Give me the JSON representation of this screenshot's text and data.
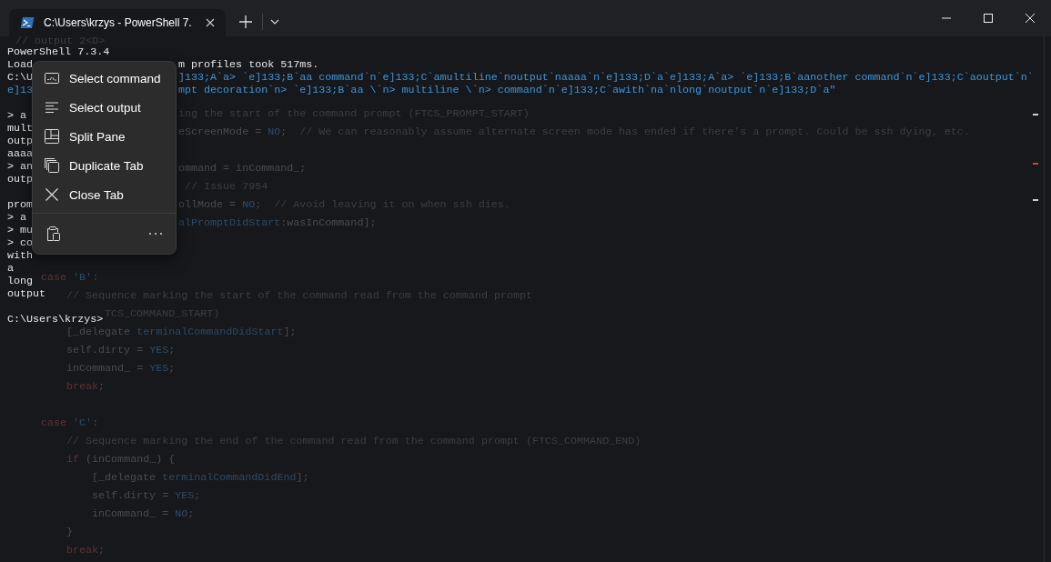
{
  "window": {
    "tabs": [
      {
        "title": "C:\\Users\\krzys - PowerShell 7.",
        "selected": true
      }
    ]
  },
  "terminal": {
    "rows": [
      {
        "kind": "text",
        "text": "PowerShell 7.3.4"
      },
      {
        "kind": "split",
        "left": {
          "text": "Load",
          "kind": "output"
        },
        "right": {
          "text": "m profiles took 517ms.",
          "kind": "output"
        }
      },
      {
        "kind": "split",
        "left": {
          "text": "C:\\U",
          "kind": "output"
        },
        "right": {
          "text": "]133;A`a> `e]133;B`aa command`n`e]133;C`amultiline`noutput`naaaa`n`e]133;D`a`e]133;A`a> `e]133;B`aanother command`n`e]133;C`aoutput`n`",
          "kind": "escape"
        }
      },
      {
        "kind": "split",
        "left": {
          "text": "e]13",
          "kind": "escape"
        },
        "right": {
          "text": "mpt decoration`n> `e]133;B`aa \\`n> multiline \\`n> command`n`e]133;C`awith`na`nlong`noutput`n`e]133;D`a\"",
          "kind": "escape"
        }
      },
      {
        "kind": "blank"
      },
      {
        "kind": "text",
        "text": "> a"
      },
      {
        "kind": "text",
        "text": "mult"
      },
      {
        "kind": "text",
        "text": "outp"
      },
      {
        "kind": "text",
        "text": "aaaa"
      },
      {
        "kind": "text",
        "text": "> an"
      },
      {
        "kind": "text",
        "text": "outp"
      },
      {
        "kind": "blank"
      },
      {
        "kind": "text",
        "text": "prom"
      },
      {
        "kind": "text",
        "text": "> a"
      },
      {
        "kind": "text",
        "text": "> mu"
      },
      {
        "kind": "text",
        "text": "> co"
      },
      {
        "kind": "text",
        "text": "with"
      },
      {
        "kind": "text",
        "text": "a"
      },
      {
        "kind": "text",
        "text": "long"
      },
      {
        "kind": "text",
        "text": "output"
      },
      {
        "kind": "blank"
      },
      {
        "kind": "text",
        "text": "C:\\Users\\krzys>"
      }
    ]
  },
  "background_code": [
    {
      "kind": "line",
      "tokens": [
        {
          "text": "// output 2<D>",
          "kind": "comment"
        }
      ]
    },
    {
      "kind": "blank"
    },
    {
      "kind": "blank"
    },
    {
      "kind": "blank"
    },
    {
      "kind": "fragment",
      "tokens": [
        {
          "text": "ing the start of the command prompt (FTCS_PROMPT_START)",
          "kind": "comment"
        }
      ]
    },
    {
      "kind": "fragment",
      "tokens": [
        {
          "text": "eScreenMode = ",
          "kind": "plain"
        },
        {
          "text": "NO",
          "kind": "literal"
        },
        {
          "text": ";  ",
          "kind": "plain"
        },
        {
          "text": "// We can reasonably assume alternate screen mode has ended if there's a prompt. Could be ssh dying, etc.",
          "kind": "comment"
        }
      ]
    },
    {
      "kind": "blank"
    },
    {
      "kind": "fragment",
      "tokens": [
        {
          "text": "ommand = inCommand_;",
          "kind": "plain"
        }
      ]
    },
    {
      "kind": "fragment",
      "tokens": [
        {
          "text": " // Issue 7954",
          "kind": "comment"
        }
      ]
    },
    {
      "kind": "fragment",
      "tokens": [
        {
          "text": "ollMode = ",
          "kind": "plain"
        },
        {
          "text": "NO",
          "kind": "literal"
        },
        {
          "text": ";  ",
          "kind": "plain"
        },
        {
          "text": "// Avoid leaving it on when ssh dies.",
          "kind": "comment"
        }
      ]
    },
    {
      "kind": "fragment",
      "tokens": [
        {
          "text": "alPromptDidStart",
          "kind": "ident"
        },
        {
          "text": ":wasInCommand];",
          "kind": "plain"
        }
      ]
    },
    {
      "kind": "blank"
    },
    {
      "kind": "blank"
    },
    {
      "kind": "block",
      "children": [
        {
          "kind": "line",
          "tokens": [
            {
              "text": "case",
              "kind": "keyword"
            },
            {
              "text": " 'B'",
              "kind": "literal"
            },
            {
              "text": ":",
              "kind": "plain"
            }
          ]
        },
        {
          "kind": "block",
          "children": [
            {
              "kind": "line",
              "tokens": [
                {
                  "text": "// Sequence marking the start of the command read from the command prompt",
                  "kind": "comment"
                }
              ]
            },
            {
              "kind": "tail",
              "tokens": [
                {
                  "text": "TCS_COMMAND_START)",
                  "kind": "comment"
                }
              ]
            },
            {
              "kind": "line",
              "tokens": [
                {
                  "text": "[_delegate ",
                  "kind": "plain"
                },
                {
                  "text": "terminalCommandDidStart",
                  "kind": "ident"
                },
                {
                  "text": "];",
                  "kind": "plain"
                }
              ]
            },
            {
              "kind": "line",
              "tokens": [
                {
                  "text": "self.dirty = ",
                  "kind": "plain"
                },
                {
                  "text": "YES",
                  "kind": "literal"
                },
                {
                  "text": ";",
                  "kind": "plain"
                }
              ]
            },
            {
              "kind": "line",
              "tokens": [
                {
                  "text": "inCommand_ = ",
                  "kind": "plain"
                },
                {
                  "text": "YES",
                  "kind": "literal"
                },
                {
                  "text": ";",
                  "kind": "plain"
                }
              ]
            },
            {
              "kind": "line",
              "tokens": [
                {
                  "text": "break",
                  "kind": "keyword"
                },
                {
                  "text": ";",
                  "kind": "plain"
                }
              ]
            }
          ]
        },
        {
          "kind": "blank"
        },
        {
          "kind": "line",
          "tokens": [
            {
              "text": "case",
              "kind": "keyword"
            },
            {
              "text": " 'C'",
              "kind": "literal"
            },
            {
              "text": ":",
              "kind": "plain"
            }
          ]
        },
        {
          "kind": "block",
          "children": [
            {
              "kind": "line",
              "tokens": [
                {
                  "text": "// Sequence marking the end of the command read from the command prompt (FTCS_COMMAND_END)",
                  "kind": "comment"
                }
              ]
            },
            {
              "kind": "line",
              "tokens": [
                {
                  "text": "if",
                  "kind": "keyword"
                },
                {
                  "text": " (inCommand_) {",
                  "kind": "plain"
                }
              ]
            },
            {
              "kind": "block",
              "children": [
                {
                  "kind": "line",
                  "tokens": [
                    {
                      "text": "[_delegate ",
                      "kind": "plain"
                    },
                    {
                      "text": "terminalCommandDidEnd",
                      "kind": "ident"
                    },
                    {
                      "text": "];",
                      "kind": "plain"
                    }
                  ]
                },
                {
                  "kind": "line",
                  "tokens": [
                    {
                      "text": "self.dirty = ",
                      "kind": "plain"
                    },
                    {
                      "text": "YES",
                      "kind": "literal"
                    },
                    {
                      "text": ";",
                      "kind": "plain"
                    }
                  ]
                },
                {
                  "kind": "line",
                  "tokens": [
                    {
                      "text": "inCommand_ = ",
                      "kind": "plain"
                    },
                    {
                      "text": "NO",
                      "kind": "literal"
                    },
                    {
                      "text": ";",
                      "kind": "plain"
                    }
                  ]
                }
              ]
            },
            {
              "kind": "line",
              "tokens": [
                {
                  "text": "}",
                  "kind": "plain"
                }
              ]
            },
            {
              "kind": "line",
              "tokens": [
                {
                  "text": "break",
                  "kind": "keyword"
                },
                {
                  "text": ";",
                  "kind": "plain"
                }
              ]
            }
          ]
        }
      ]
    }
  ],
  "context_menu": {
    "items": [
      {
        "label": "Select command"
      },
      {
        "label": "Select output"
      },
      {
        "label": "Split Pane"
      },
      {
        "label": "Duplicate Tab"
      },
      {
        "label": "Close Tab"
      }
    ]
  }
}
